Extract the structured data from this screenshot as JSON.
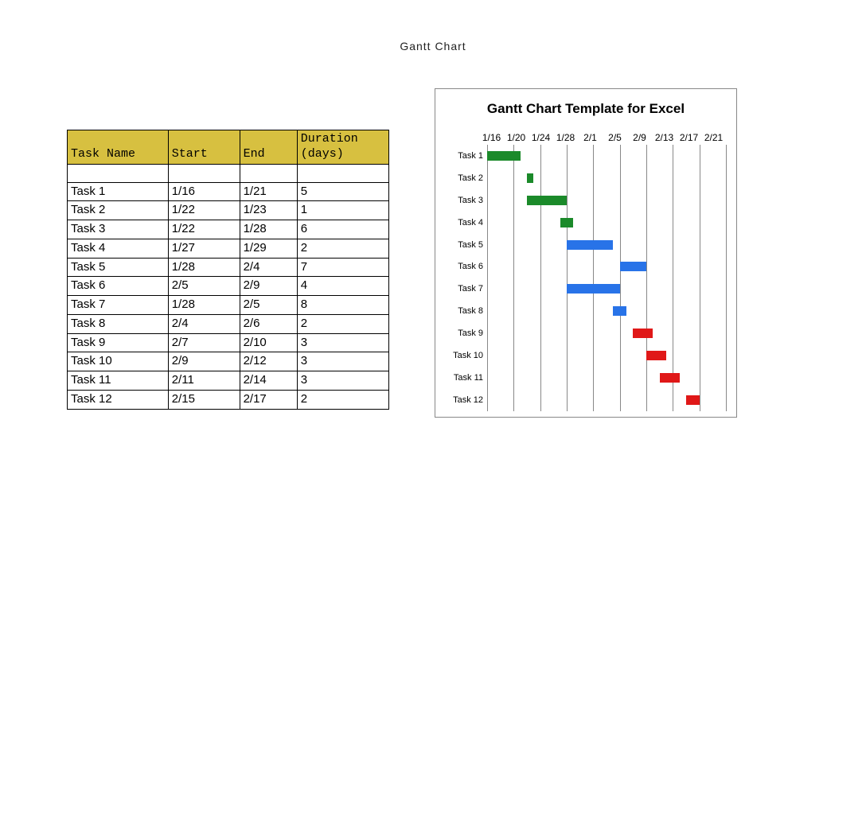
{
  "title": "Gantt Chart",
  "table": {
    "headers": {
      "task": "Task Name",
      "start": "Start",
      "end": "End",
      "duration": "Duration (days)"
    },
    "rows": [
      {
        "task": "",
        "start": "",
        "end": "",
        "duration": ""
      },
      {
        "task": "Task 1",
        "start": "1/16",
        "end": "1/21",
        "duration": "5"
      },
      {
        "task": "Task 2",
        "start": "1/22",
        "end": "1/23",
        "duration": "1"
      },
      {
        "task": "Task 3",
        "start": "1/22",
        "end": "1/28",
        "duration": "6"
      },
      {
        "task": "Task 4",
        "start": "1/27",
        "end": "1/29",
        "duration": "2"
      },
      {
        "task": "Task 5",
        "start": "1/28",
        "end": "2/4",
        "duration": "7"
      },
      {
        "task": "Task 6",
        "start": "2/5",
        "end": "2/9",
        "duration": "4"
      },
      {
        "task": "Task 7",
        "start": "1/28",
        "end": "2/5",
        "duration": "8"
      },
      {
        "task": "Task 8",
        "start": "2/4",
        "end": "2/6",
        "duration": "2"
      },
      {
        "task": "Task 9",
        "start": "2/7",
        "end": "2/10",
        "duration": "3"
      },
      {
        "task": "Task 10",
        "start": "2/9",
        "end": "2/12",
        "duration": "3"
      },
      {
        "task": "Task 11",
        "start": "2/11",
        "end": "2/14",
        "duration": "3"
      },
      {
        "task": "Task 12",
        "start": "2/15",
        "end": "2/17",
        "duration": "2"
      }
    ]
  },
  "chart_data": {
    "type": "bar",
    "title": "Gantt Chart Template for Excel",
    "x_axis_ticks": [
      "1/16",
      "1/20",
      "1/24",
      "1/28",
      "2/1",
      "2/5",
      "2/9",
      "2/13",
      "2/17",
      "2/21"
    ],
    "x_range_days": {
      "min": 0,
      "max": 36
    },
    "categories": [
      "Task 1",
      "Task 2",
      "Task 3",
      "Task 4",
      "Task 5",
      "Task 6",
      "Task 7",
      "Task 8",
      "Task 9",
      "Task 10",
      "Task 11",
      "Task 12"
    ],
    "series": [
      {
        "name": "Task 1",
        "start_day": 0,
        "duration": 5,
        "color": "green"
      },
      {
        "name": "Task 2",
        "start_day": 6,
        "duration": 1,
        "color": "green"
      },
      {
        "name": "Task 3",
        "start_day": 6,
        "duration": 6,
        "color": "green"
      },
      {
        "name": "Task 4",
        "start_day": 11,
        "duration": 2,
        "color": "green"
      },
      {
        "name": "Task 5",
        "start_day": 12,
        "duration": 7,
        "color": "blue"
      },
      {
        "name": "Task 6",
        "start_day": 20,
        "duration": 4,
        "color": "blue"
      },
      {
        "name": "Task 7",
        "start_day": 12,
        "duration": 8,
        "color": "blue"
      },
      {
        "name": "Task 8",
        "start_day": 19,
        "duration": 2,
        "color": "blue"
      },
      {
        "name": "Task 9",
        "start_day": 22,
        "duration": 3,
        "color": "red"
      },
      {
        "name": "Task 10",
        "start_day": 24,
        "duration": 3,
        "color": "red"
      },
      {
        "name": "Task 11",
        "start_day": 26,
        "duration": 3,
        "color": "red"
      },
      {
        "name": "Task 12",
        "start_day": 30,
        "duration": 2,
        "color": "red"
      }
    ]
  }
}
